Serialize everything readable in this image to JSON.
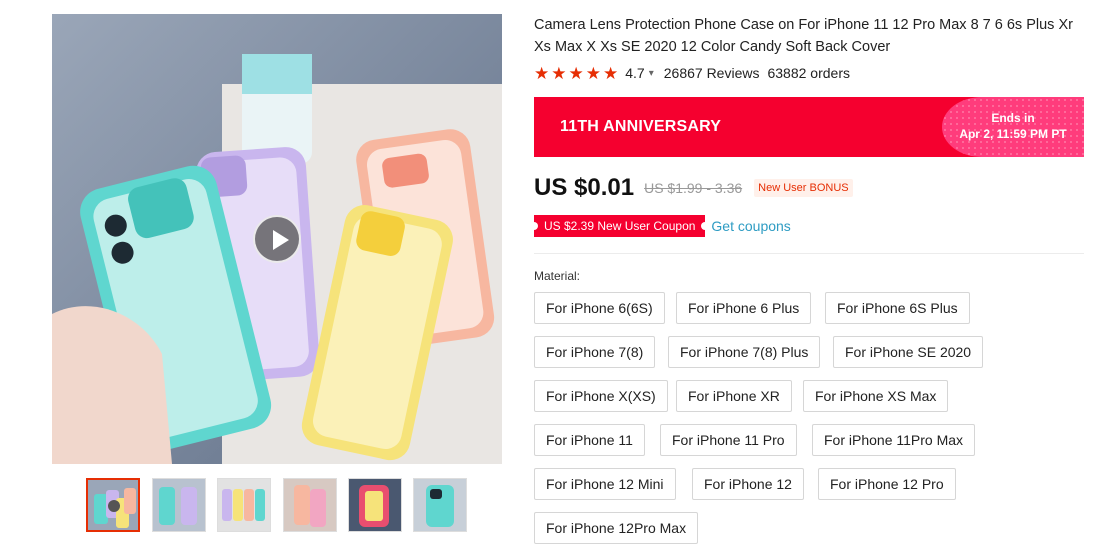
{
  "product": {
    "title": "Camera Lens Protection Phone Case on For iPhone 11 12 Pro Max 8 7 6 6s Plus Xr Xs Max X Xs SE 2020 12 Color Candy Soft Back Cover",
    "rating_value": "4.7",
    "rating_stars": 5,
    "reviews": "26867 Reviews",
    "orders": "63882 orders"
  },
  "banner": {
    "title": "11TH ANNIVERSARY",
    "ends_label": "Ends in",
    "ends_time": "Apr 2, 11:59 PM PT"
  },
  "price": {
    "current": "US $0.01",
    "original": "US $1.99 - 3.36",
    "badge": "New User BONUS"
  },
  "coupon": {
    "label": "US $2.39 New User Coupon",
    "get_link": "Get coupons"
  },
  "material": {
    "label": "Material:",
    "options": [
      "For iPhone 6(6S)",
      "For iPhone 6 Plus",
      "For iPhone 6S Plus",
      "For iPhone 7(8)",
      "For iPhone 7(8) Plus",
      "For iPhone SE 2020",
      "For iPhone X(XS)",
      "For iPhone XR",
      "For iPhone XS Max",
      "For iPhone 11",
      "For iPhone 11 Pro",
      "For iPhone 11Pro Max",
      "For iPhone 12 Mini",
      "For iPhone 12",
      "For iPhone 12 Pro",
      "For iPhone 12Pro Max"
    ]
  },
  "gallery": {
    "thumbnail_count": 6,
    "active_index": 0
  },
  "colors": {
    "accent": "#e62e04",
    "banner": "#f5002f",
    "banner_ends": "#ff3c7c",
    "link": "#2e9cc3",
    "case_mint": "#5fd6cf",
    "case_lavender": "#c9b6ee",
    "case_yellow": "#f6e37a",
    "case_peach": "#f7b7a0"
  }
}
